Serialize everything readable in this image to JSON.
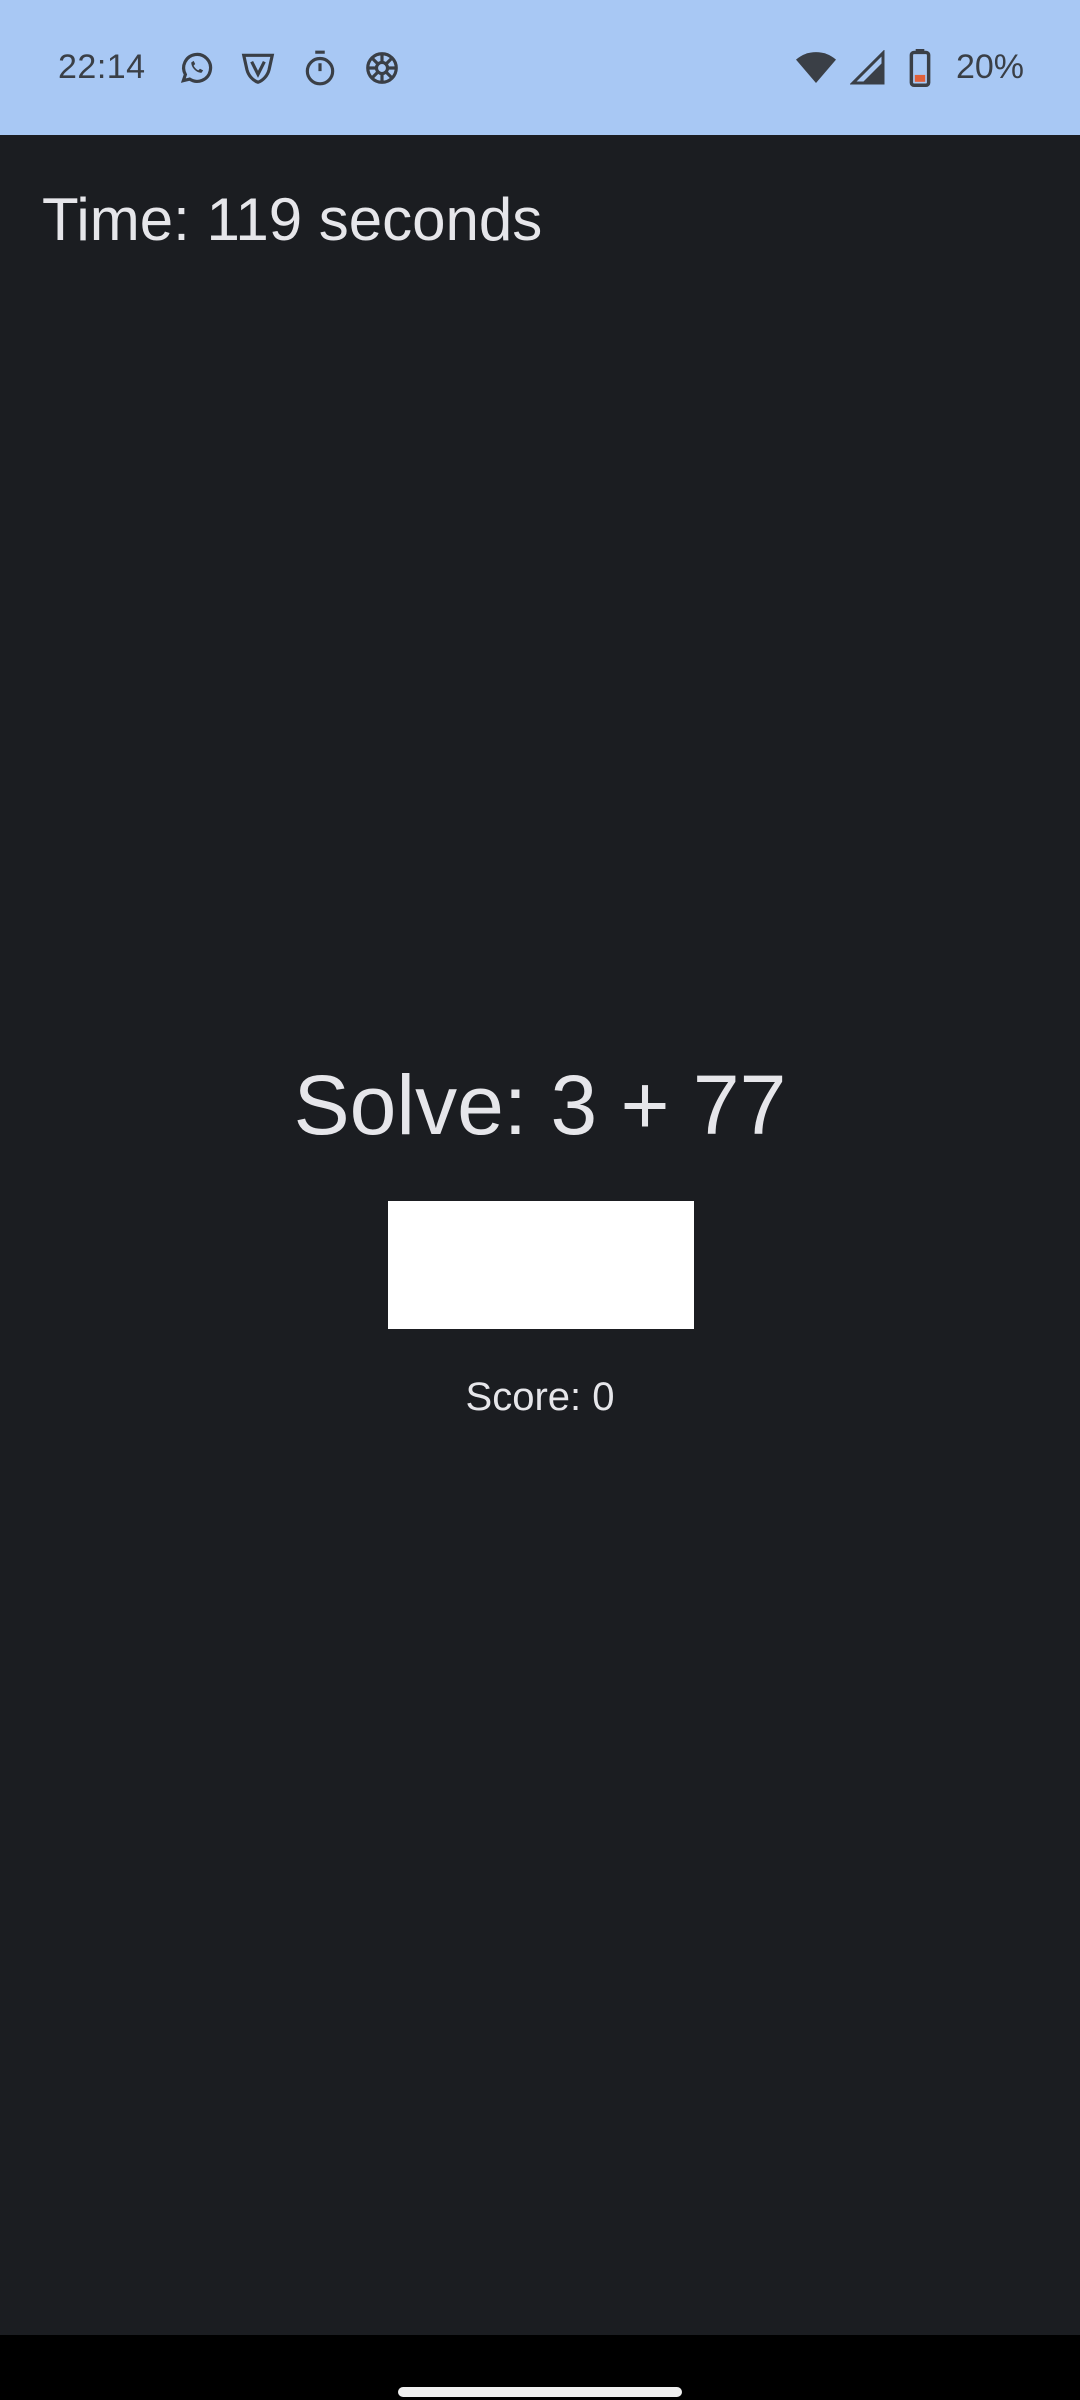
{
  "status_bar": {
    "time": "22:14",
    "notification_icons": [
      "whatsapp-icon",
      "shield-vpn-icon",
      "stopwatch-icon",
      "aperture-icon"
    ],
    "battery_percent": "20%",
    "background_color": "#a8c8f4"
  },
  "game": {
    "timer_text": "Time: 119 seconds",
    "problem_text": "Solve: 3 + 77",
    "answer_value": "",
    "answer_placeholder": "",
    "score_text": "Score: 0"
  },
  "colors": {
    "background": "#1b1d21",
    "text": "#e6e6ea",
    "input_background": "#ffffff"
  }
}
